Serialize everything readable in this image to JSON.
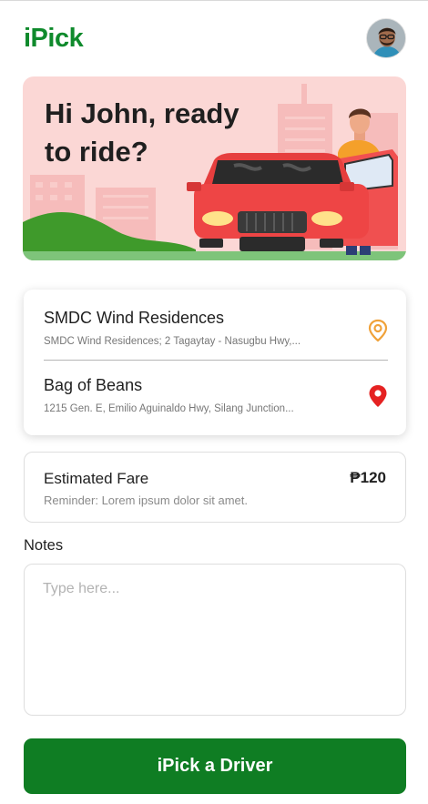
{
  "app": {
    "title": "iPick"
  },
  "header": {
    "avatar_icon": "user-avatar"
  },
  "banner": {
    "greeting": "Hi John, ready\nto ride?",
    "illustration": "red-car-with-driver"
  },
  "route": {
    "pickup": {
      "name": "SMDC Wind Residences",
      "address": "SMDC Wind Residences; 2 Tagaytay - Nasugbu Hwy,...",
      "icon": "pin-outline-icon",
      "color": "#f0a23a"
    },
    "dropoff": {
      "name": "Bag of Beans",
      "address": "1215 Gen. E, Emilio Aguinaldo Hwy, Silang Junction...",
      "icon": "pin-filled-icon",
      "color": "#e52222"
    }
  },
  "fare": {
    "label": "Estimated Fare",
    "amount": "₱120",
    "reminder": "Reminder: Lorem ipsum dolor sit amet."
  },
  "notes": {
    "label": "Notes",
    "placeholder": "Type here..."
  },
  "actions": {
    "primary": "iPick a Driver"
  },
  "colors": {
    "brand": "#0f8a2c",
    "button": "#0f7d23",
    "banner_bg": "#fbd7d5"
  }
}
